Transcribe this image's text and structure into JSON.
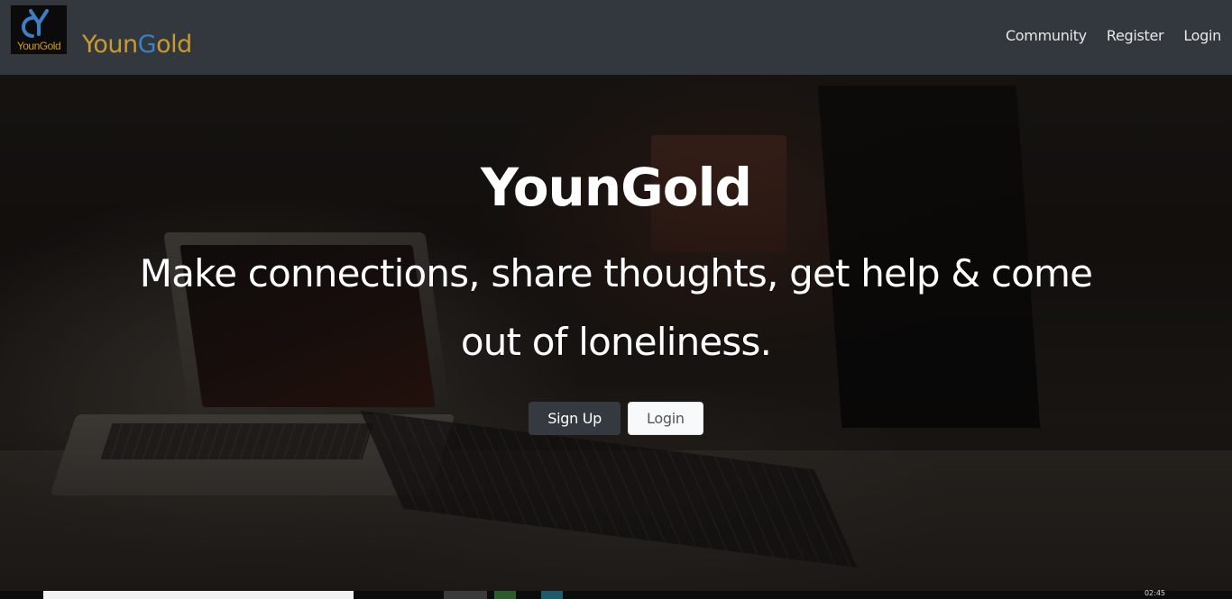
{
  "brand": {
    "logo_text": "YounGold",
    "name_part1": "Youn",
    "name_highlight": "G",
    "name_part2": "old"
  },
  "nav": {
    "items": [
      {
        "label": "Community"
      },
      {
        "label": "Register"
      },
      {
        "label": "Login"
      }
    ]
  },
  "hero": {
    "title": "YounGold",
    "tagline": "Make connections, share thoughts, get help & come out of loneliness.",
    "signup_label": "Sign Up",
    "login_label": "Login"
  },
  "taskbar": {
    "time": "02:45"
  },
  "colors": {
    "navbar_bg": "#343a40",
    "brand_gold": "#c99a2e",
    "brand_blue": "#3b7fc4",
    "btn_dark": "#343a40",
    "btn_light": "#f8f9fa"
  }
}
